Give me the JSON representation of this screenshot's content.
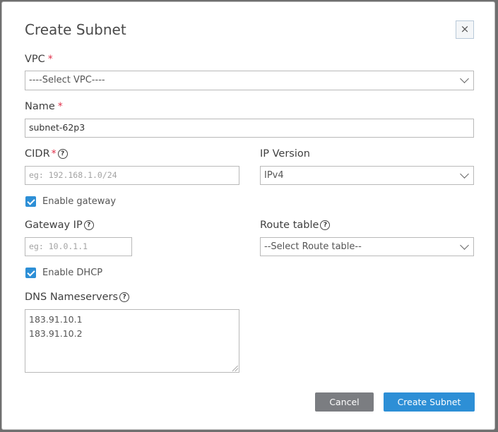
{
  "dialog": {
    "title": "Create Subnet",
    "close_icon": "×"
  },
  "vpc": {
    "label": "VPC",
    "required_mark": "*",
    "selected": "----Select VPC----"
  },
  "name": {
    "label": "Name",
    "required_mark": "*",
    "value": "subnet-62p3"
  },
  "cidr": {
    "label": "CIDR",
    "required_mark": "*",
    "placeholder": "eg: 192.168.1.0/24",
    "help_icon": "?"
  },
  "ip_version": {
    "label": "IP Version",
    "selected": "IPv4"
  },
  "enable_gateway": {
    "label": "Enable gateway",
    "checked": true
  },
  "gateway_ip": {
    "label": "Gateway IP",
    "placeholder": "eg: 10.0.1.1",
    "help_icon": "?"
  },
  "route_table": {
    "label": "Route table",
    "selected": "--Select Route table--",
    "help_icon": "?"
  },
  "enable_dhcp": {
    "label": "Enable DHCP",
    "checked": true
  },
  "dns": {
    "label": "DNS Nameservers",
    "help_icon": "?",
    "lines": [
      "183.91.10.1",
      "183.91.10.2"
    ]
  },
  "footer": {
    "cancel_label": "Cancel",
    "create_label": "Create Subnet"
  },
  "colors": {
    "primary": "#2d8fd6",
    "cancel": "#7b7d81",
    "required": "#e0314b"
  }
}
